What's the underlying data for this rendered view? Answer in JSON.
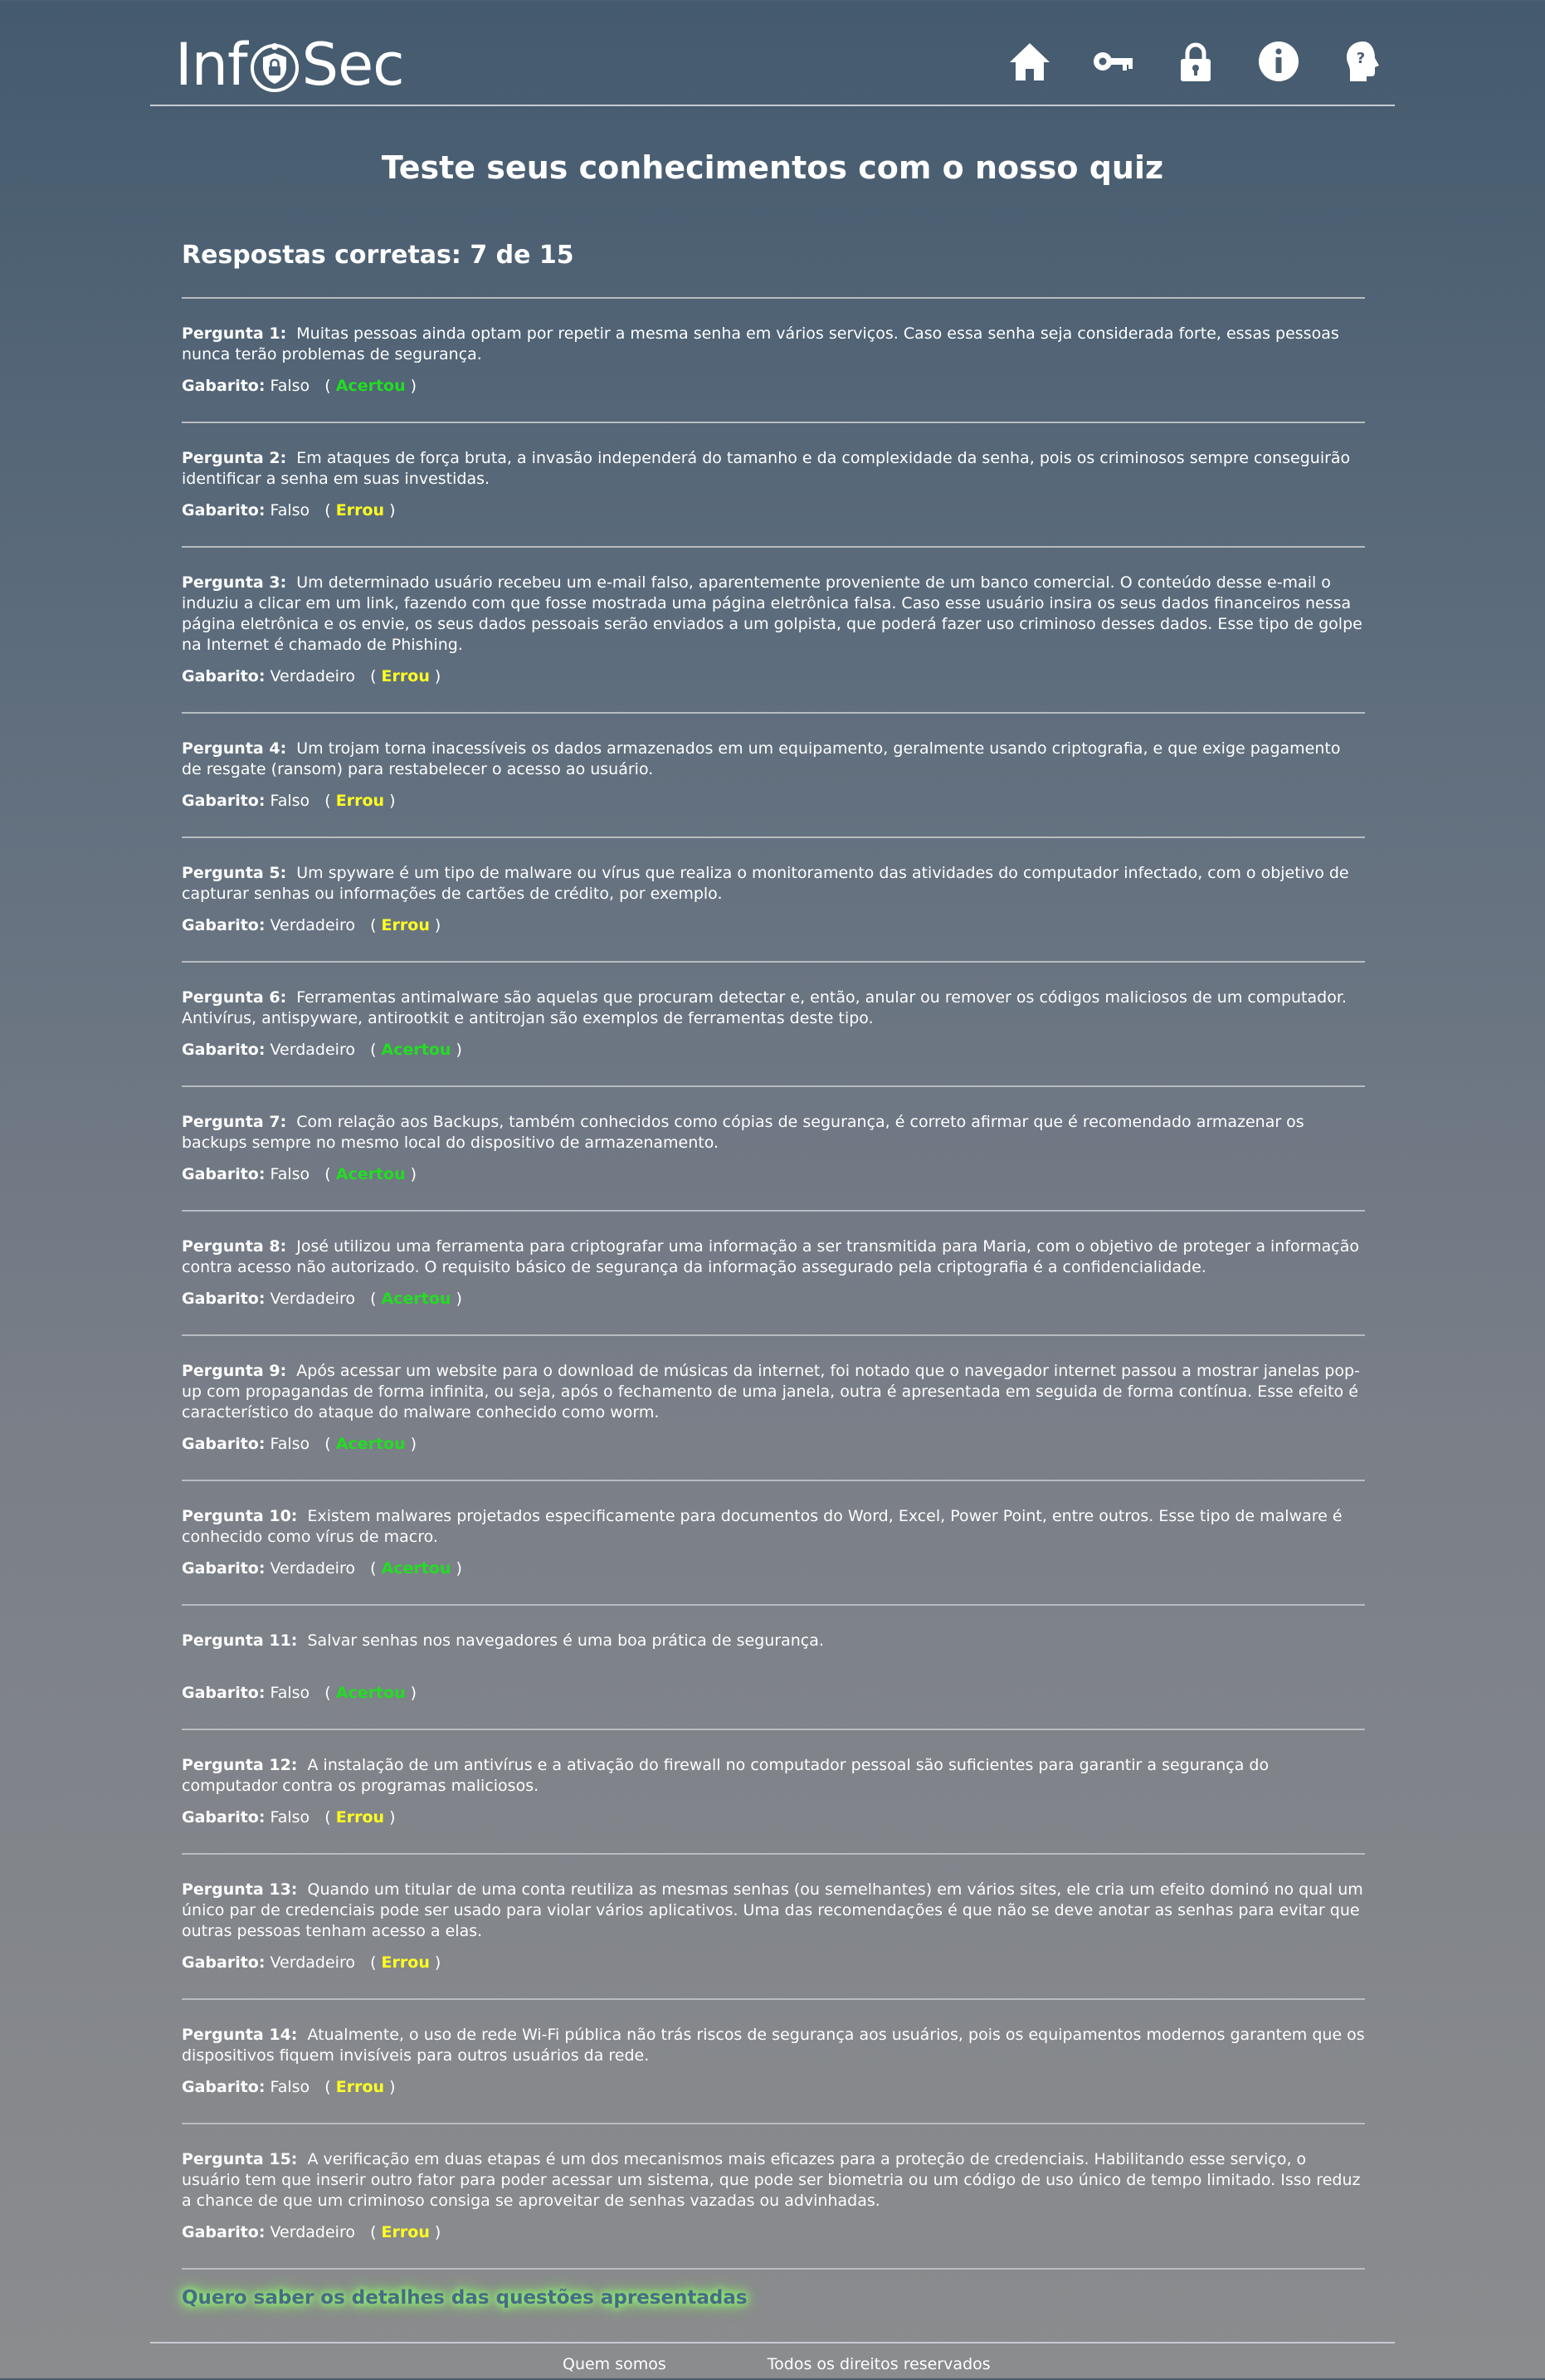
{
  "header": {
    "logo_left": "Inf",
    "logo_right": "Sec",
    "nav": [
      {
        "name": "home-icon",
        "label": "home"
      },
      {
        "name": "key-icon",
        "label": "key"
      },
      {
        "name": "lock-icon",
        "label": "lock"
      },
      {
        "name": "info-icon",
        "label": "info"
      },
      {
        "name": "head-question-icon",
        "label": "help"
      }
    ]
  },
  "title": "Teste seus conhecimentos com o nosso quiz",
  "score": "Respostas corretas: 7 de 15",
  "labels": {
    "gabarito": "Gabarito:"
  },
  "questions": [
    {
      "label": "Pergunta 1:",
      "text": "Muitas pessoas ainda optam por repetir a mesma senha em vários serviços. Caso essa senha seja considerada forte, essas pessoas nunca terão problemas de segurança.",
      "answer": "Falso",
      "result": "Acertou"
    },
    {
      "label": "Pergunta 2:",
      "text": "Em ataques de força bruta, a invasão independerá do tamanho e da complexidade da senha, pois os criminosos sempre conseguirão identificar a senha em suas investidas.",
      "answer": "Falso",
      "result": "Errou"
    },
    {
      "label": "Pergunta 3:",
      "text": "Um determinado usuário recebeu um e-mail falso, aparentemente proveniente de um banco comercial. O conteúdo desse e-mail o induziu a clicar em um link, fazendo com que fosse mostrada uma página eletrônica falsa. Caso esse usuário insira os seus dados financeiros nessa página eletrônica e os envie, os seus dados pessoais serão enviados a um golpista, que poderá fazer uso criminoso desses dados. Esse tipo de golpe na Internet é chamado de Phishing.",
      "answer": "Verdadeiro",
      "result": "Errou"
    },
    {
      "label": "Pergunta 4:",
      "text": "Um trojam torna inacessíveis os dados armazenados em um equipamento, geralmente usando criptografia, e que exige pagamento de resgate (ransom) para restabelecer o acesso ao usuário.",
      "answer": "Falso",
      "result": "Errou"
    },
    {
      "label": "Pergunta 5:",
      "text": "Um spyware é um tipo de malware ou vírus que realiza o monitoramento das atividades do computador infectado, com o objetivo de capturar senhas ou informações de cartões de crédito, por exemplo.",
      "answer": "Verdadeiro",
      "result": "Errou"
    },
    {
      "label": "Pergunta 6:",
      "text": "Ferramentas antimalware são aquelas que procuram detectar e, então, anular ou remover os códigos maliciosos de um computador. Antivírus, antispyware, antirootkit e antitrojan são exemplos de ferramentas deste tipo.",
      "answer": "Verdadeiro",
      "result": "Acertou"
    },
    {
      "label": "Pergunta 7:",
      "text": "Com relação aos Backups, também conhecidos como cópias de segurança, é correto afirmar que é recomendado armazenar os backups sempre no mesmo local do dispositivo de armazenamento.",
      "answer": "Falso",
      "result": "Acertou"
    },
    {
      "label": "Pergunta 8:",
      "text": "José utilizou uma ferramenta para criptografar uma informação a ser transmitida para Maria, com o objetivo de proteger a informação contra acesso não autorizado. O requisito básico de segurança da informação assegurado pela criptografia é a confidencialidade.",
      "answer": "Verdadeiro",
      "result": "Acertou"
    },
    {
      "label": "Pergunta 9:",
      "text": "Após acessar um website para o download de músicas da internet, foi notado que o navegador internet passou a mostrar janelas pop-up com propagandas de forma infinita, ou seja, após o fechamento de uma janela, outra é apresentada em seguida de forma contínua. Esse efeito é característico do ataque do malware conhecido como worm.",
      "answer": "Falso",
      "result": "Acertou"
    },
    {
      "label": "Pergunta 10:",
      "text": "Existem malwares projetados especificamente para documentos do Word, Excel, Power Point, entre outros. Esse tipo de malware é conhecido como vírus de macro.",
      "answer": "Verdadeiro",
      "result": "Acertou"
    },
    {
      "label": "Pergunta 11:",
      "text": "Salvar senhas nos navegadores é uma boa prática de segurança.",
      "answer": "Falso",
      "result": "Acertou"
    },
    {
      "label": "Pergunta 12:",
      "text": "A instalação de um antivírus e a ativação do firewall no computador pessoal são suficientes para garantir a segurança do computador contra os programas maliciosos.",
      "answer": "Falso",
      "result": "Errou"
    },
    {
      "label": "Pergunta 13:",
      "text": "Quando um titular de uma conta reutiliza as mesmas senhas (ou semelhantes) em vários sites, ele cria um efeito dominó no qual um único par de credenciais pode ser usado para violar vários aplicativos. Uma das recomendações é que não se deve anotar as senhas para evitar que outras pessoas tenham acesso a elas.",
      "answer": "Verdadeiro",
      "result": "Errou"
    },
    {
      "label": "Pergunta 14:",
      "text": "Atualmente, o uso de rede Wi-Fi pública não trás riscos de segurança aos usuários, pois os equipamentos modernos garantem que os dispositivos fiquem invisíveis para outros usuários da rede.",
      "answer": "Falso",
      "result": "Errou"
    },
    {
      "label": "Pergunta 15:",
      "text": "A verificação em duas etapas é um dos mecanismos mais eficazes para a proteção de credenciais. Habilitando esse serviço, o usuário tem que inserir outro fator para poder acessar um sistema, que pode ser biometria ou um código de uso único de tempo limitado. Isso reduz a chance de que um criminoso consiga se aproveitar de senhas vazadas ou advinhadas.",
      "answer": "Verdadeiro",
      "result": "Errou"
    }
  ],
  "details_link": "Quero saber os detalhes das questões apresentadas",
  "footer": {
    "about": "Quem somos",
    "rights": "Todos os direitos reservados"
  },
  "colors": {
    "correct": "#22dd22",
    "wrong": "#ffff22",
    "link_glow": "#8cff6a"
  }
}
